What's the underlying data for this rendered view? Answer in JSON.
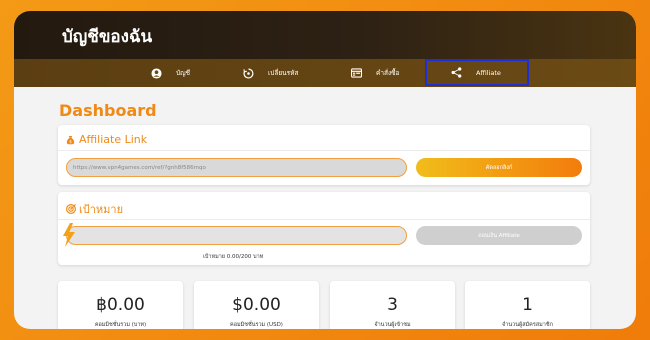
{
  "header": {
    "title": "บัญชีของฉัน"
  },
  "nav": {
    "items": [
      {
        "label": "บัญชี",
        "icon": "account-circle-icon"
      },
      {
        "label": "เปลี่ยนรหัส",
        "icon": "reset-password-icon"
      },
      {
        "label": "คำสั่งซื้อ",
        "icon": "orders-icon"
      },
      {
        "label": "Affiliate",
        "icon": "share-icon",
        "active": true
      }
    ]
  },
  "dashboard": {
    "title": "Dashboard"
  },
  "affiliate_link": {
    "title": "Affiliate Link",
    "url_value": "https://www.vpn4games.com/ref/?gnh8f586mqo",
    "copy_button": "คัดลอกลิงก์"
  },
  "goal": {
    "title": "เป้าหมาย",
    "progress_fraction": 0,
    "progress_text": "เป้าหมาย 0.00/200 บาท",
    "withdraw_button": "ถอนเงิน Affiliate"
  },
  "stats": [
    {
      "value": "฿0.00",
      "label": "คอมมิชชั่นรวม (บาท)"
    },
    {
      "value": "$0.00",
      "label": "คอมมิชชั่นรวม (USD)"
    },
    {
      "value": "3",
      "label": "จำนวนผู้เข้าชม"
    },
    {
      "value": "1",
      "label": "จำนวนผู้สมัครสมาชิก"
    }
  ],
  "colors": {
    "accent": "#f08a16",
    "header_dark": "#2d2114",
    "nav_brown": "#6b4a14",
    "active_outline": "#1f2fd6"
  }
}
